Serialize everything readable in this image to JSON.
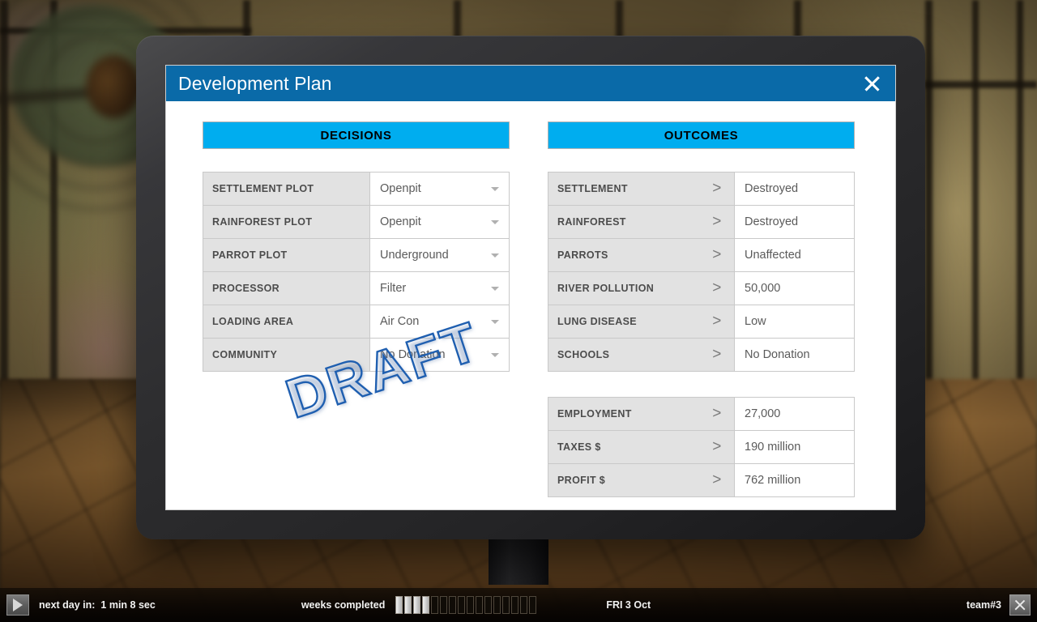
{
  "window": {
    "title": "Development Plan",
    "close_icon": "close-icon"
  },
  "columns": {
    "decisions_header": "DECISIONS",
    "outcomes_header": "OUTCOMES"
  },
  "decisions": [
    {
      "label": "SETTLEMENT PLOT",
      "value": "Openpit"
    },
    {
      "label": "RAINFOREST PLOT",
      "value": "Openpit"
    },
    {
      "label": "PARROT PLOT",
      "value": "Underground"
    },
    {
      "label": "PROCESSOR",
      "value": "Filter"
    },
    {
      "label": "LOADING AREA",
      "value": "Air Con"
    },
    {
      "label": "COMMUNITY",
      "value": "No Donation"
    }
  ],
  "outcomes_primary": [
    {
      "label": "SETTLEMENT",
      "arrow": ">",
      "value": "Destroyed"
    },
    {
      "label": "RAINFOREST",
      "arrow": ">",
      "value": "Destroyed"
    },
    {
      "label": "PARROTS",
      "arrow": ">",
      "value": "Unaffected"
    },
    {
      "label": "RIVER POLLUTION",
      "arrow": ">",
      "value": "50,000"
    },
    {
      "label": "LUNG DISEASE",
      "arrow": ">",
      "value": "Low"
    },
    {
      "label": "SCHOOLS",
      "arrow": ">",
      "value": "No Donation"
    }
  ],
  "outcomes_secondary": [
    {
      "label": "EMPLOYMENT",
      "arrow": ">",
      "value": "27,000"
    },
    {
      "label": "TAXES $",
      "arrow": ">",
      "value": "190 million"
    },
    {
      "label": "PROFIT $",
      "arrow": ">",
      "value": "762 million"
    }
  ],
  "watermark": "DRAFT",
  "statusbar": {
    "play_icon": "play-icon",
    "next_day": "next day in:  1 min 8 sec",
    "weeks_label": "weeks completed",
    "weeks_total": 16,
    "weeks_completed": 4,
    "date": "FRI 3 Oct",
    "team": "team#3",
    "close_icon": "close-icon"
  },
  "colors": {
    "titlebar": "#0a6aa8",
    "header_accent": "#00adef",
    "row_label_bg": "#e2e2e2",
    "draft_outline": "#1f5fb0"
  }
}
